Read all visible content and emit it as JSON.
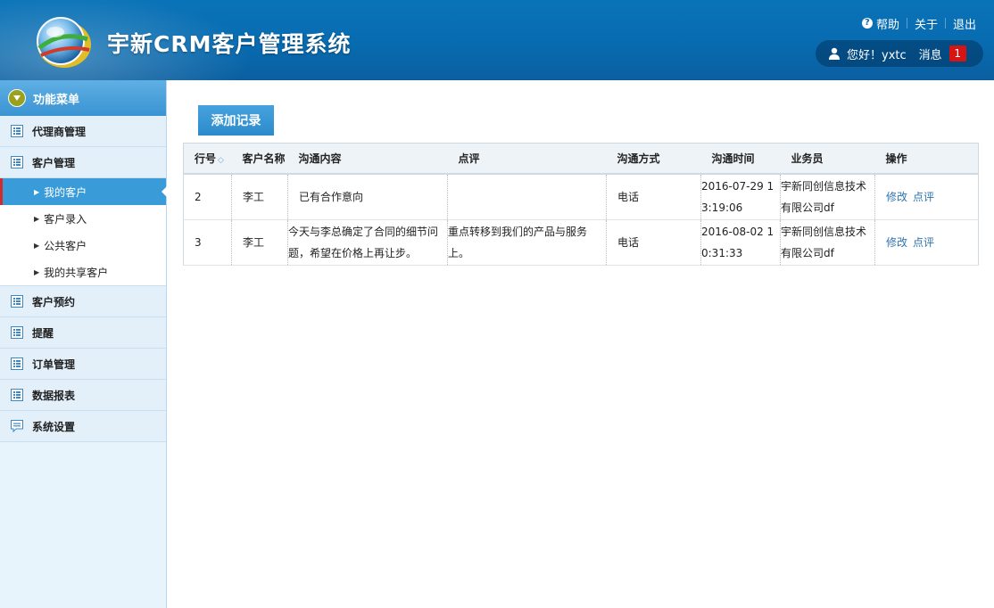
{
  "header": {
    "title": "宇新CRM客户管理系统",
    "help": "帮助",
    "about": "关于",
    "logout": "退出",
    "greeting": "您好！yxtc",
    "messages_label": "消息",
    "messages_count": "1"
  },
  "sidebar": {
    "menu_title": "功能菜单",
    "sections": {
      "agent": "代理商管理",
      "customer": "客户管理",
      "appointment": "客户预约",
      "reminder": "提醒",
      "order": "订单管理",
      "report": "数据报表",
      "settings": "系统设置"
    },
    "customer_items": [
      "我的客户",
      "客户录入",
      "公共客户",
      "我的共享客户"
    ]
  },
  "main": {
    "add_button": "添加记录",
    "columns": [
      "行号",
      "客户名称",
      "沟通内容",
      "点评",
      "沟通方式",
      "沟通时间",
      "业务员",
      "操作"
    ],
    "rows": [
      {
        "no": "2",
        "customer": "李工",
        "content": "已有合作意向",
        "comment": "",
        "method": "电话",
        "time": "2016-07-29 13:19:06",
        "salesman": "宇新同创信息技术有限公司df",
        "edit": "修改",
        "review": "点评"
      },
      {
        "no": "3",
        "customer": "李工",
        "content": "今天与李总确定了合同的细节问题，希望在价格上再让步。",
        "comment": "重点转移到我们的产品与服务上。",
        "method": "电话",
        "time": "2016-08-02 10:31:33",
        "salesman": "宇新同创信息技术有限公司df",
        "edit": "修改",
        "review": "点评"
      }
    ]
  }
}
